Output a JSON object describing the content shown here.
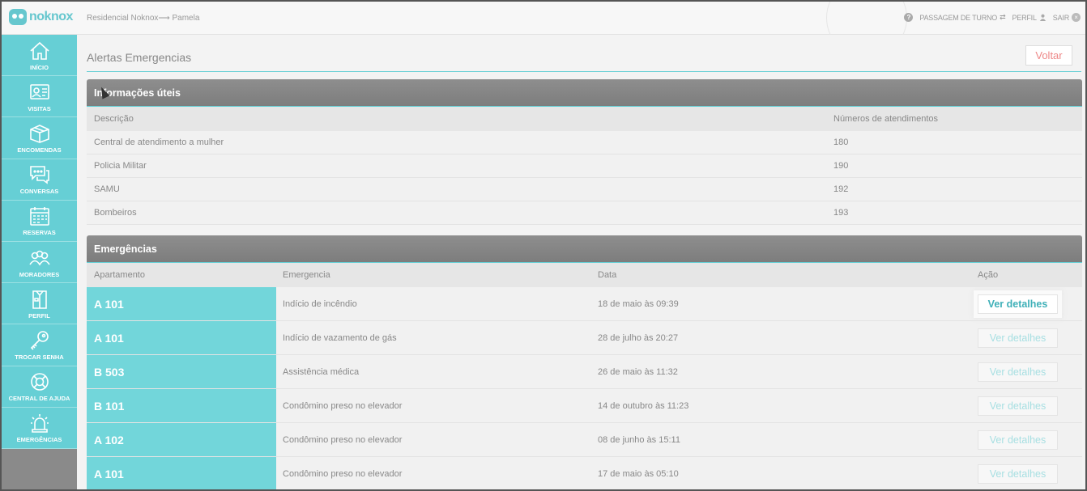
{
  "app": {
    "brand": "noknox",
    "breadcrumb": "Residencial Noknox⟶ Pamela"
  },
  "topnav": {
    "help": "?",
    "shift_change": "PASSAGEM DE TURNO",
    "shift_icon": "⇄",
    "profile": "PERFIL",
    "exit": "SAIR",
    "exit_icon": "×"
  },
  "sidebar": {
    "items": [
      {
        "label": "INÍCIO",
        "icon": "home-icon"
      },
      {
        "label": "VISITAS",
        "icon": "id-card-icon"
      },
      {
        "label": "ENCOMENDAS",
        "icon": "box-icon"
      },
      {
        "label": "CONVERSAS",
        "icon": "chat-icon"
      },
      {
        "label": "RESERVAS",
        "icon": "calendar-icon"
      },
      {
        "label": "MORADORES",
        "icon": "people-icon"
      },
      {
        "label": "PERFIL",
        "icon": "shirt-icon"
      },
      {
        "label": "TROCAR SENHA",
        "icon": "key-icon"
      },
      {
        "label": "CENTRAL DE AJUDA",
        "icon": "lifebuoy-icon"
      },
      {
        "label": "EMERGÊNCIAS",
        "icon": "siren-icon"
      }
    ]
  },
  "page": {
    "title": "Alertas Emergencias",
    "back_label": "Voltar"
  },
  "info_panel": {
    "title": "Informações úteis",
    "columns": [
      "Descrição",
      "Números de atendimentos"
    ],
    "rows": [
      {
        "desc": "Central de atendimento a mulher",
        "num": "180"
      },
      {
        "desc": "Policia Militar",
        "num": "190"
      },
      {
        "desc": "SAMU",
        "num": "192"
      },
      {
        "desc": "Bombeiros",
        "num": "193"
      }
    ]
  },
  "emergency_panel": {
    "title": "Emergências",
    "columns": [
      "Apartamento",
      "Emergencia",
      "Data",
      "Ação"
    ],
    "action_label": "Ver detalhes",
    "rows": [
      {
        "apt": "A 101",
        "emergency": "Indício de incêndio",
        "date": "18 de maio às 09:39"
      },
      {
        "apt": "A 101",
        "emergency": "Indício de vazamento de gás",
        "date": "28 de julho às 20:27"
      },
      {
        "apt": "B 503",
        "emergency": "Assistência médica",
        "date": "26 de maio às 11:32"
      },
      {
        "apt": "B 101",
        "emergency": "Condômino preso no elevador",
        "date": "14 de outubro às 11:23"
      },
      {
        "apt": "A 102",
        "emergency": "Condômino preso no elevador",
        "date": "08 de junho às 15:11"
      },
      {
        "apt": "A 101",
        "emergency": "Condômino preso no elevador",
        "date": "17 de maio às 05:10"
      }
    ]
  },
  "colors": {
    "accent": "#66cfd5",
    "header_gray": "#858585",
    "back_text": "#ee8888"
  }
}
